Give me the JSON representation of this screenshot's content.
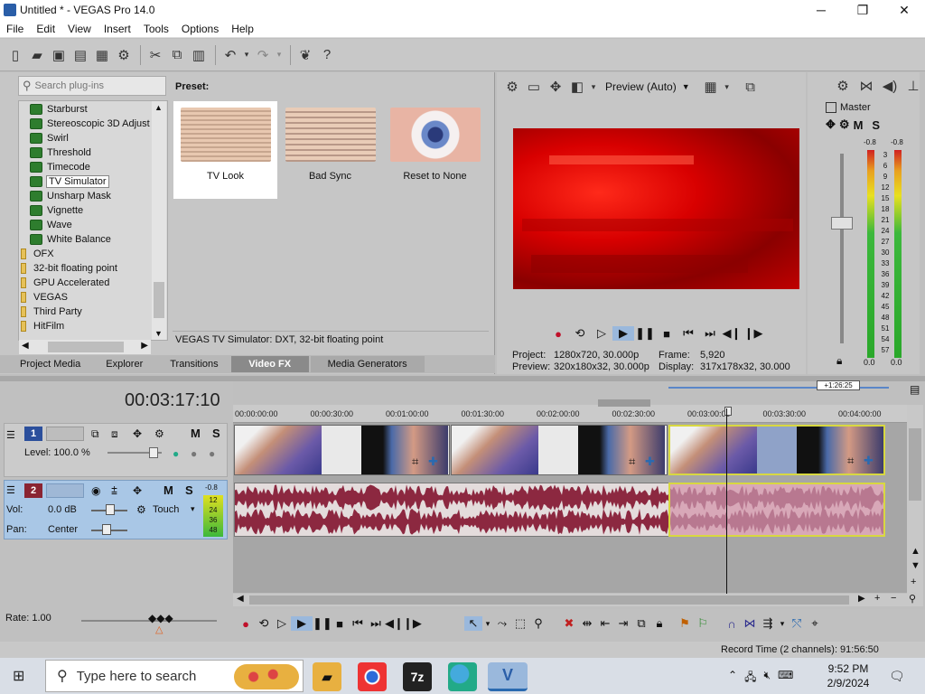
{
  "window": {
    "title": "Untitled * - VEGAS Pro 14.0",
    "minimize": "─",
    "maximize": "❐",
    "close": "✕"
  },
  "menu": [
    "File",
    "Edit",
    "View",
    "Insert",
    "Tools",
    "Options",
    "Help"
  ],
  "fx": {
    "search_placeholder": "Search plug-ins",
    "tree": [
      {
        "label": "Starburst",
        "type": "plugin"
      },
      {
        "label": "Stereoscopic 3D Adjust",
        "type": "plugin"
      },
      {
        "label": "Swirl",
        "type": "plugin"
      },
      {
        "label": "Threshold",
        "type": "plugin"
      },
      {
        "label": "Timecode",
        "type": "plugin"
      },
      {
        "label": "TV Simulator",
        "type": "plugin",
        "selected": true
      },
      {
        "label": "Unsharp Mask",
        "type": "plugin"
      },
      {
        "label": "Vignette",
        "type": "plugin"
      },
      {
        "label": "Wave",
        "type": "plugin"
      },
      {
        "label": "White Balance",
        "type": "plugin"
      },
      {
        "label": "OFX",
        "type": "folder"
      },
      {
        "label": "32-bit floating point",
        "type": "folder"
      },
      {
        "label": "GPU Accelerated",
        "type": "folder"
      },
      {
        "label": "VEGAS",
        "type": "folder"
      },
      {
        "label": "Third Party",
        "type": "folder"
      },
      {
        "label": "HitFilm",
        "type": "folder"
      }
    ],
    "preset_label": "Preset:",
    "presets": [
      "TV Look",
      "Bad Sync",
      "Reset to None"
    ],
    "description": "VEGAS TV Simulator: DXT, 32-bit floating point",
    "tabs": [
      "Project Media",
      "Explorer",
      "Transitions",
      "Video FX",
      "Media Generators"
    ],
    "active_tab": "Video FX"
  },
  "preview": {
    "quality": "Preview (Auto)",
    "project_label": "Project:",
    "project_value": "1280x720, 30.000p",
    "preview_label": "Preview:",
    "preview_value": "320x180x32, 30.000p",
    "frame_label": "Frame:",
    "frame_value": "5,920",
    "display_label": "Display:",
    "display_value": "317x178x32, 30.000"
  },
  "master": {
    "label": "Master",
    "m": "M",
    "s": "S",
    "peak_left": "-0.8",
    "peak_right": "-0.8",
    "scale": [
      "3",
      "6",
      "9",
      "12",
      "15",
      "18",
      "21",
      "24",
      "27",
      "30",
      "33",
      "36",
      "39",
      "42",
      "45",
      "48",
      "51",
      "54",
      "57"
    ],
    "bottom_left": "0.0",
    "bottom_right": "0.0"
  },
  "timeline": {
    "timecode": "00:03:17:10",
    "loop_marker": "+1:26:25",
    "ruler": [
      "00:00:00:00",
      "00:00:30:00",
      "00:01:00:00",
      "00:01:30:00",
      "00:02:00:00",
      "00:02:30:00",
      "00:03:00:00",
      "00:03:30:00",
      "00:04:00:00"
    ],
    "track1": {
      "num": "1",
      "level": "Level: 100.0 %",
      "m": "M",
      "s": "S"
    },
    "track2": {
      "num": "2",
      "vol_label": "Vol:",
      "vol_value": "0.0 dB",
      "pan_label": "Pan:",
      "pan_value": "Center",
      "mode": "Touch",
      "m": "M",
      "s": "S",
      "peak": "-0.8",
      "meter": [
        "12",
        "24",
        "36",
        "48"
      ]
    },
    "rate": "Rate: 1.00"
  },
  "status": {
    "record_time": "Record Time (2 channels): 91:56:50"
  },
  "taskbar": {
    "search_placeholder": "Type here to search",
    "time": "9:52 PM",
    "date": "2/9/2024",
    "zip_label": "7z"
  },
  "icons": {
    "lock": "🔒",
    "search": "⚲"
  }
}
